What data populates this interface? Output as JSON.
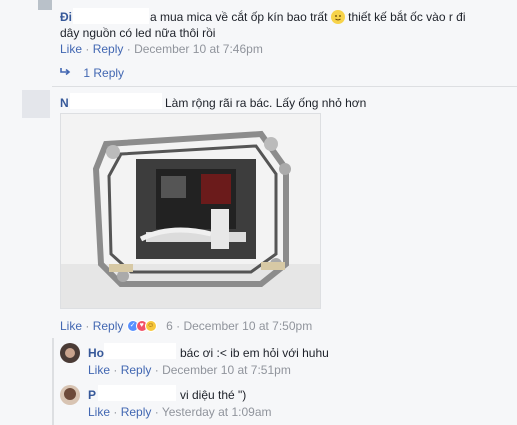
{
  "comment1": {
    "author": "Đi",
    "text_line1": "a mua mica về cắt ốp kín bao trất",
    "text_line1b": "thiết kế bắt ốc vào r đi",
    "text_line2": "dây nguồn có led nữa thôi rồi",
    "like": "Like",
    "reply": "Reply",
    "time": "December 10 at 7:46pm",
    "replies_link": "1 Reply",
    "emoji_icon": "smiley-face-icon"
  },
  "comment2": {
    "author": "N",
    "text": "Làm rộng rãi ra bác. Lấy ống nhỏ hơn",
    "like": "Like",
    "reply": "Reply",
    "reaction_count": "6",
    "time": "December 10 at 7:50pm",
    "reactions": [
      "like",
      "love",
      "haha"
    ]
  },
  "reply1": {
    "author": "Ho",
    "text": "bác ơi :< ib em hỏi với huhu",
    "like": "Like",
    "reply": "Reply",
    "time": "December 10 at 7:51pm"
  },
  "reply2": {
    "author": "P",
    "text": "vi diệu thé \")",
    "like": "Like",
    "reply": "Reply",
    "time": "Yesterday at 1:09am"
  },
  "separator": "·",
  "colors": {
    "link": "#4267b2",
    "name": "#365899",
    "meta": "#90949c",
    "text": "#1d2129"
  }
}
